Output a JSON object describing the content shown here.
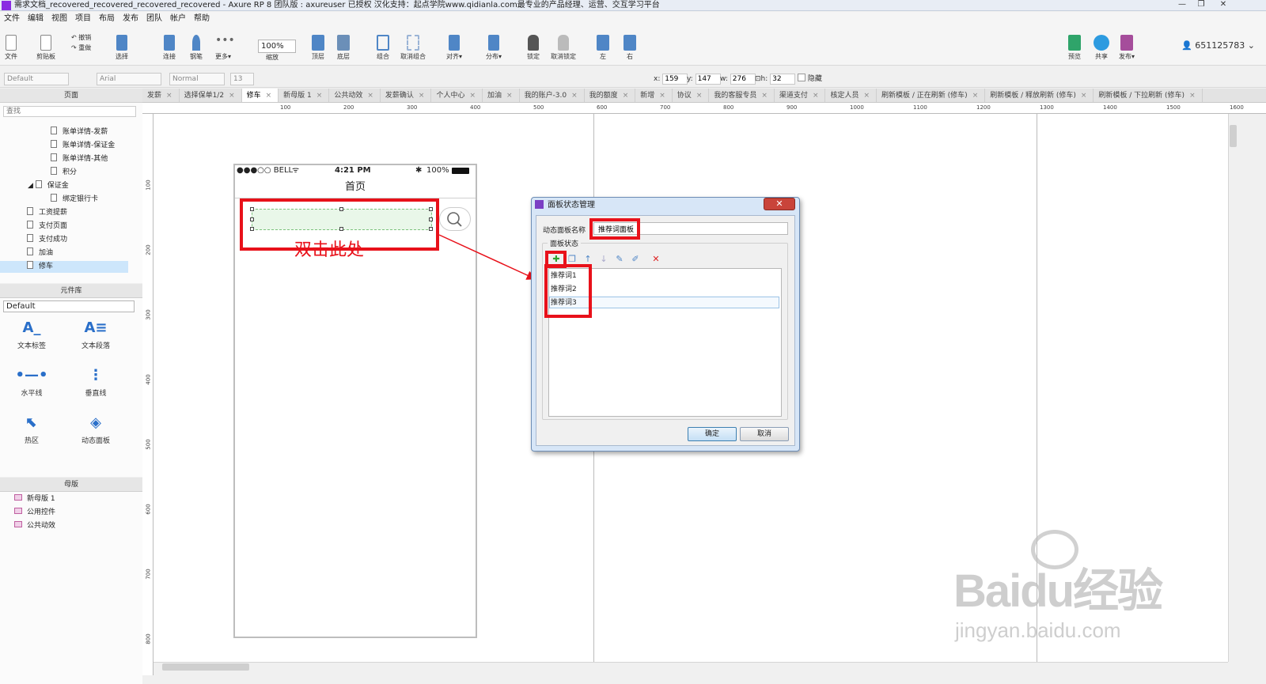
{
  "window": {
    "title": "需求文档_recovered_recovered_recovered_recovered - Axure RP 8 团队版 : axureuser 已授权 汉化支持：起点学院www.qidianla.com最专业的产品经理、运营、交互学习平台",
    "controls": [
      "—",
      "❐",
      "✕"
    ]
  },
  "menu": [
    "文件",
    "编辑",
    "视图",
    "项目",
    "布局",
    "发布",
    "团队",
    "帐户",
    "帮助"
  ],
  "toolbar": {
    "file": "文件",
    "clipboard": "剪贴板",
    "undo": "撤销",
    "redo": "重做",
    "select": "选择",
    "connect": "连接",
    "pen": "钢笔",
    "more": "更多▾",
    "zoom_value": "100%",
    "zoom_label": "缩放",
    "top": "顶层",
    "bottom": "底层",
    "group": "组合",
    "ungroup": "取消组合",
    "align": "对齐▾",
    "distribute": "分布▾",
    "lock": "锁定",
    "unlock": "取消锁定",
    "left": "左",
    "right": "右",
    "preview": "预览",
    "share": "共享",
    "publish": "发布▾",
    "user": "651125783"
  },
  "format": {
    "style": "Default",
    "font": "Arial",
    "weight": "Normal",
    "size": "13",
    "x_label": "x:",
    "x": "159",
    "y_label": "y:",
    "y": "147",
    "w_label": "w:",
    "w": "276",
    "h_label": "h:",
    "h": "32",
    "hidden_label": "隐藏"
  },
  "pages_panel": {
    "title": "页面",
    "search_placeholder": "查找",
    "items": [
      "账单详情-发薪",
      "账单详情-保证金",
      "账单详情-其他",
      "积分",
      "保证金",
      "绑定银行卡",
      "工资提薪",
      "支付页面",
      "支付成功",
      "加油",
      "修车"
    ]
  },
  "library_panel": {
    "title": "元件库",
    "selected": "Default",
    "widgets": [
      "文本标签",
      "文本段落",
      "水平线",
      "垂直线",
      "热区",
      "动态面板"
    ]
  },
  "masters_panel": {
    "title": "母版",
    "items": [
      "新母版 1",
      "公用控件",
      "公共动效"
    ]
  },
  "tabs": [
    "发薪",
    "选择保单1/2",
    "修车",
    "新母版 1",
    "公共动效",
    "发薪确认",
    "个人中心",
    "加油",
    "我的账户-3.0",
    "我的额度",
    "新增",
    "协议",
    "我的客服专员",
    "渠道支付",
    "核定人员",
    "刷新模板 / 正在刷新 (修车)",
    "刷新模板 / 释放刷新 (修车)",
    "刷新模板 / 下拉刷新 (修车)"
  ],
  "ruler": {
    "h_ticks": [
      "100",
      "200",
      "300",
      "400",
      "500",
      "600",
      "700",
      "800",
      "900",
      "1000",
      "1100",
      "1200",
      "1300",
      "1400",
      "1500",
      "1600"
    ],
    "v_ticks": [
      "100",
      "200",
      "300",
      "400",
      "500",
      "600",
      "700",
      "800"
    ]
  },
  "phone": {
    "carrier": "●●●○○ BELL",
    "wifi": "ᯤ",
    "time": "4:21 PM",
    "bt": "✱",
    "battery": "100%",
    "nav_title": "首页",
    "annotation": "双击此处"
  },
  "dialog": {
    "title": "面板状态管理",
    "name_label": "动态面板名称",
    "name_value": "推荐词面板",
    "group_label": "面板状态",
    "states": [
      "推荐词1",
      "推荐词2",
      "推荐词3"
    ],
    "ok": "确定",
    "cancel": "取消"
  },
  "watermark": {
    "brand": "Baidu经验",
    "url": "jingyan.baidu.com"
  },
  "colors": {
    "annotation_red": "#e8111a",
    "selection": "#cde6fb",
    "accent_blue": "#2a6fc9"
  }
}
